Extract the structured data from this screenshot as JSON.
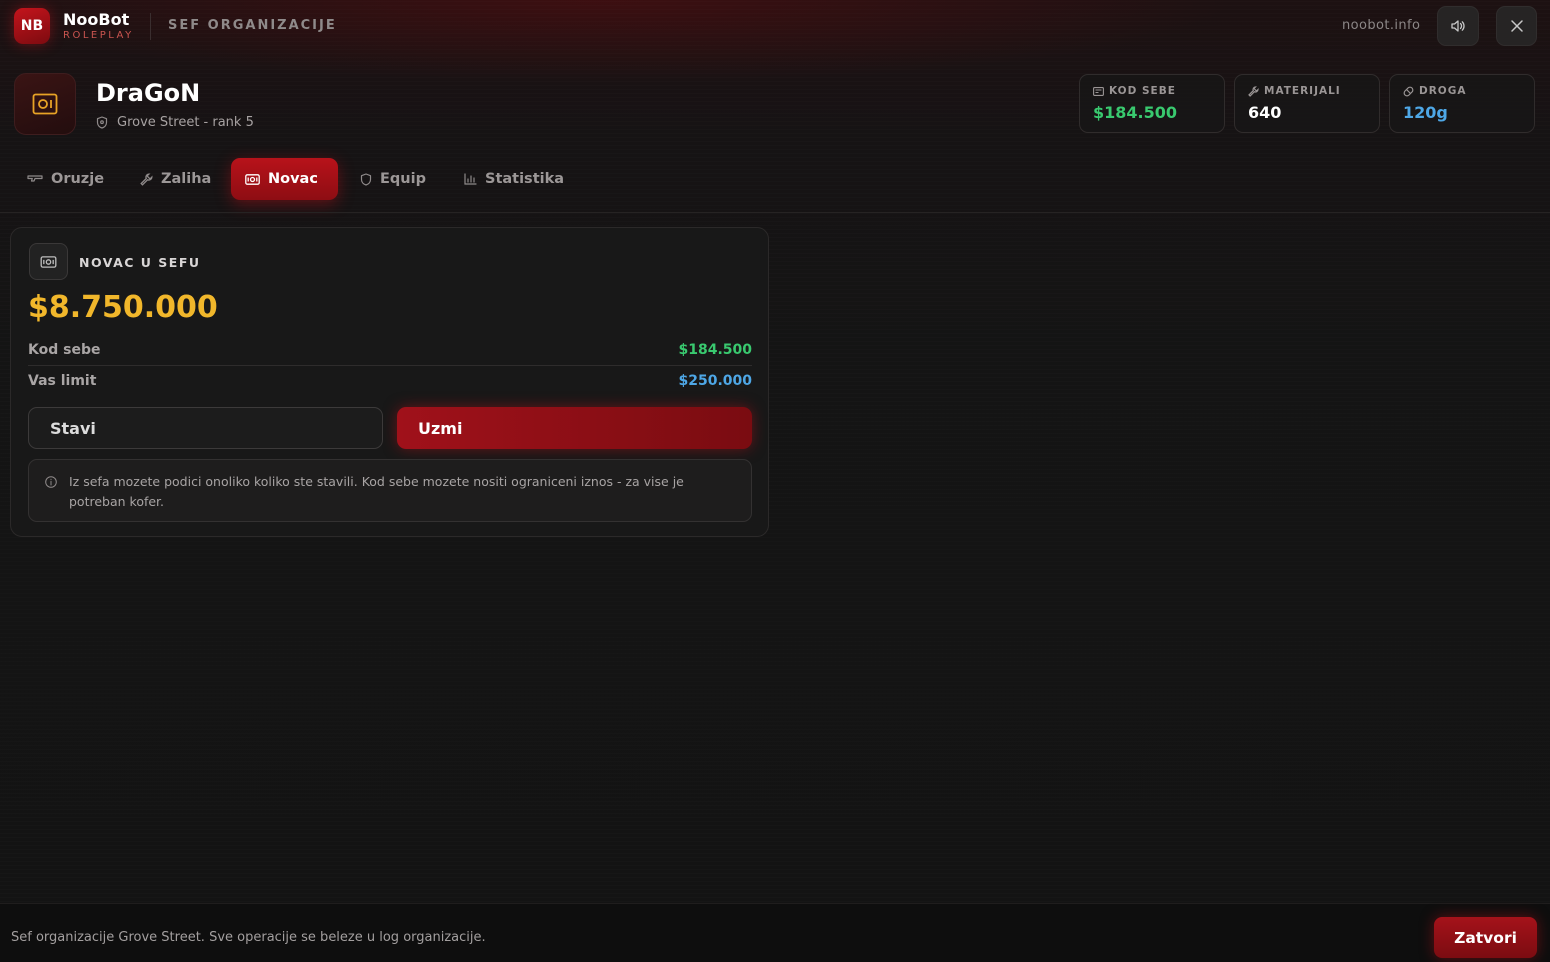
{
  "topbar": {
    "logo_text": "NB",
    "brand_name": "NooBot",
    "brand_sub": "ROLEPLAY",
    "section_title": "SEF ORGANIZACIJE",
    "site": "noobot.info",
    "sound_icon": "speaker-icon",
    "close_icon": "close-icon"
  },
  "player": {
    "name": "DraGoN",
    "subtitle": "Grove Street - rank 5",
    "avatar_icon": "safe-icon",
    "subtitle_icon": "shield-icon"
  },
  "stats": [
    {
      "label": "KOD SEBE",
      "value": "$184.500",
      "color": "#39c96f",
      "icon": "wallet-icon"
    },
    {
      "label": "MATERIJALI",
      "value": "640",
      "color": "#ffffff",
      "icon": "wrench-icon"
    },
    {
      "label": "DROGA",
      "value": "120g",
      "color": "#4ea7e6",
      "icon": "pill-icon"
    }
  ],
  "tabs": [
    {
      "label": "Oruzje",
      "icon": "gun-icon",
      "active": false
    },
    {
      "label": "Zaliha",
      "icon": "wrench-icon",
      "active": false
    },
    {
      "label": "Novac",
      "icon": "cash-icon",
      "active": true
    },
    {
      "label": "Equip",
      "icon": "shield-icon",
      "active": false
    },
    {
      "label": "Statistika",
      "icon": "bar-chart-icon",
      "active": false
    }
  ],
  "panel": {
    "title": "NOVAC U SEFU",
    "amount": "$8.750.000",
    "amount_color": "#f1b72b",
    "rows": [
      {
        "label": "Kod sebe",
        "value": "$184.500",
        "color": "#39c96f"
      },
      {
        "label": "Vas limit",
        "value": "$250.000",
        "color": "#4ea7e6"
      }
    ],
    "deposit_label": "Stavi",
    "withdraw_label": "Uzmi",
    "info": "Iz sefa mozete podici onoliko koliko ste stavili. Kod sebe mozete nositi ograniceni iznos - za vise je potreban kofer."
  },
  "footer": {
    "text": "Sef organizacije Grove Street. Sve operacije se beleze u log organizacije.",
    "close_label": "Zatvori"
  },
  "colors": {
    "accent": "#b8121a",
    "gold": "#f1b72b",
    "green": "#39c96f",
    "blue": "#4ea7e6"
  }
}
